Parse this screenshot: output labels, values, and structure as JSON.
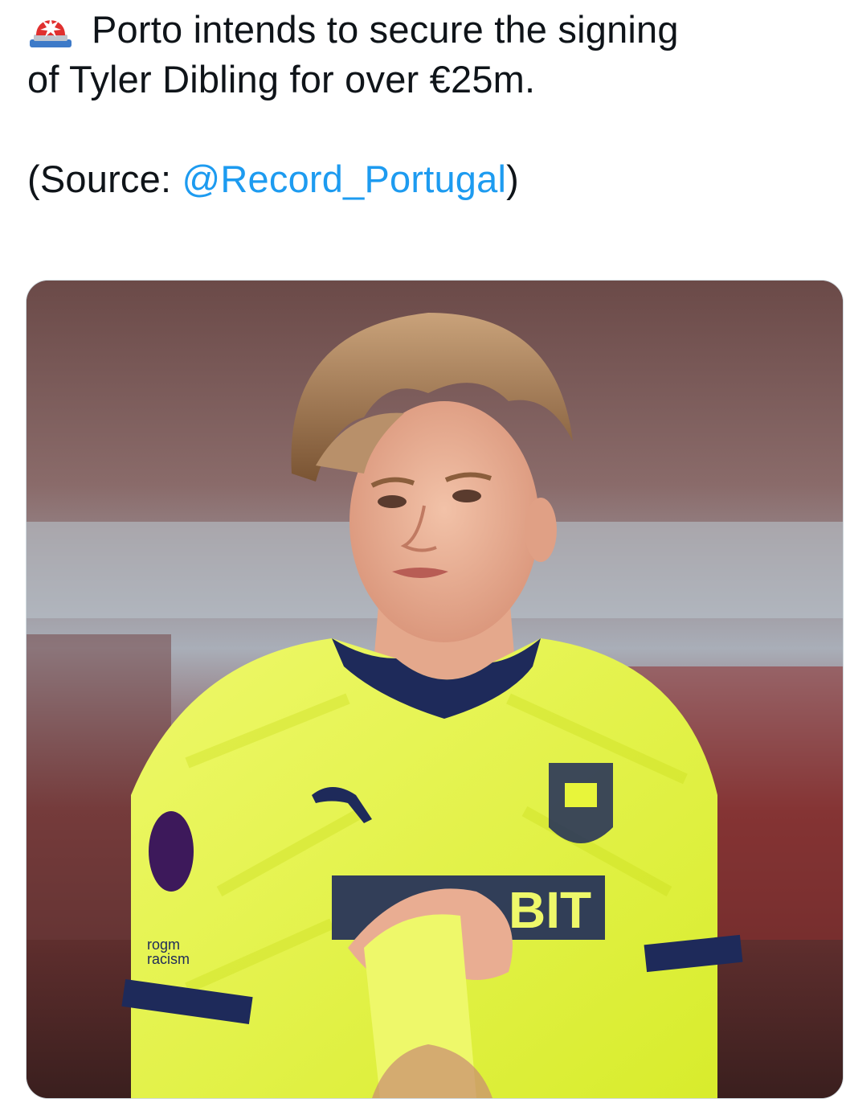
{
  "tweet": {
    "emoji_icon": "police-car-light-icon",
    "line1": "Porto intends to secure the signing",
    "line2": "of Tyler Dibling for over €25m.",
    "source_prefix": "(Source: ",
    "source_mention": "@Record_Portugal",
    "source_suffix": ")"
  },
  "media": {
    "description_icon": "player-photo",
    "shirt_sponsor": "BIT",
    "sleeve_text_1": "rogm",
    "sleeve_text_2": "racism"
  },
  "colors": {
    "text": "#0f1419",
    "mention": "#1d9bf0",
    "kit_yellow": "#e8f53a",
    "kit_navy": "#1e2a5a"
  }
}
